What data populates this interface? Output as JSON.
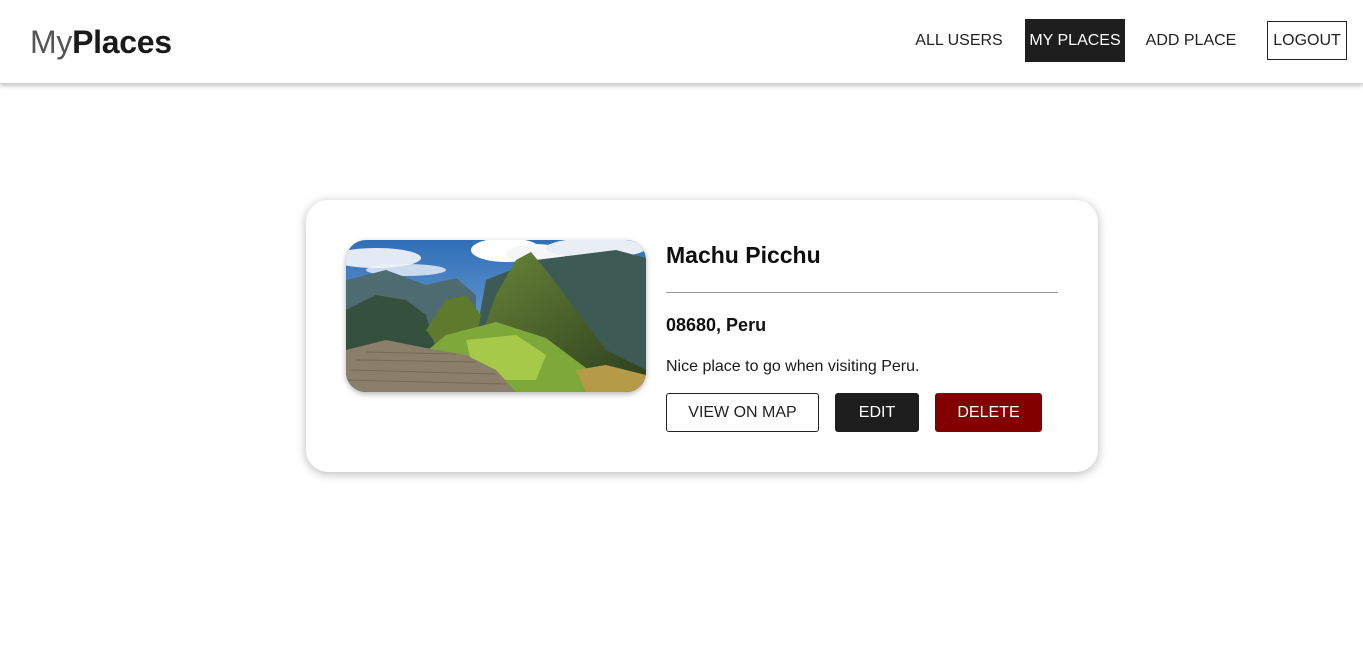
{
  "header": {
    "logo_light": "My",
    "logo_bold": "Places",
    "nav": {
      "all_users": "ALL USERS",
      "my_places": "MY PLACES",
      "add_place": "ADD PLACE",
      "logout": "LOGOUT"
    }
  },
  "place": {
    "image_subject": "machu-picchu-photo",
    "title": "Machu Picchu",
    "address": "08680, Peru",
    "description": "Nice place to go when visiting Peru.",
    "actions": {
      "view_on_map": "VIEW ON MAP",
      "edit": "EDIT",
      "delete": "DELETE"
    }
  },
  "colors": {
    "active_nav": "#1e1e1e",
    "edit_button": "#1e1e1e",
    "delete_button": "#830000"
  }
}
